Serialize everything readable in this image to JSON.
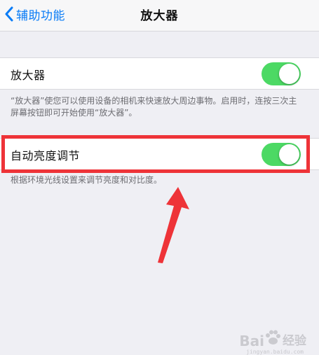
{
  "navbar": {
    "back_label": "辅助功能",
    "title": "放大器"
  },
  "magnifier_row": {
    "label": "放大器",
    "toggle_on": true
  },
  "magnifier_footnote": "“放大器”使您可以使用设备的相机来快速放大周边事物。启用时，连按三次主屏幕按钮即可开始使用“放大器”。",
  "auto_brightness_row": {
    "label": "自动亮度调节",
    "toggle_on": true
  },
  "auto_brightness_footnote": "根据环境光线设置来调节亮度和对比度。",
  "colors": {
    "accent": "#0a7cf6",
    "toggle_on": "#4cd964",
    "highlight": "#ee3338",
    "background": "#efeff4"
  },
  "watermark": {
    "brand": "Bai",
    "brand_suffix": "经验",
    "url": "jingyan.baidu.com"
  }
}
